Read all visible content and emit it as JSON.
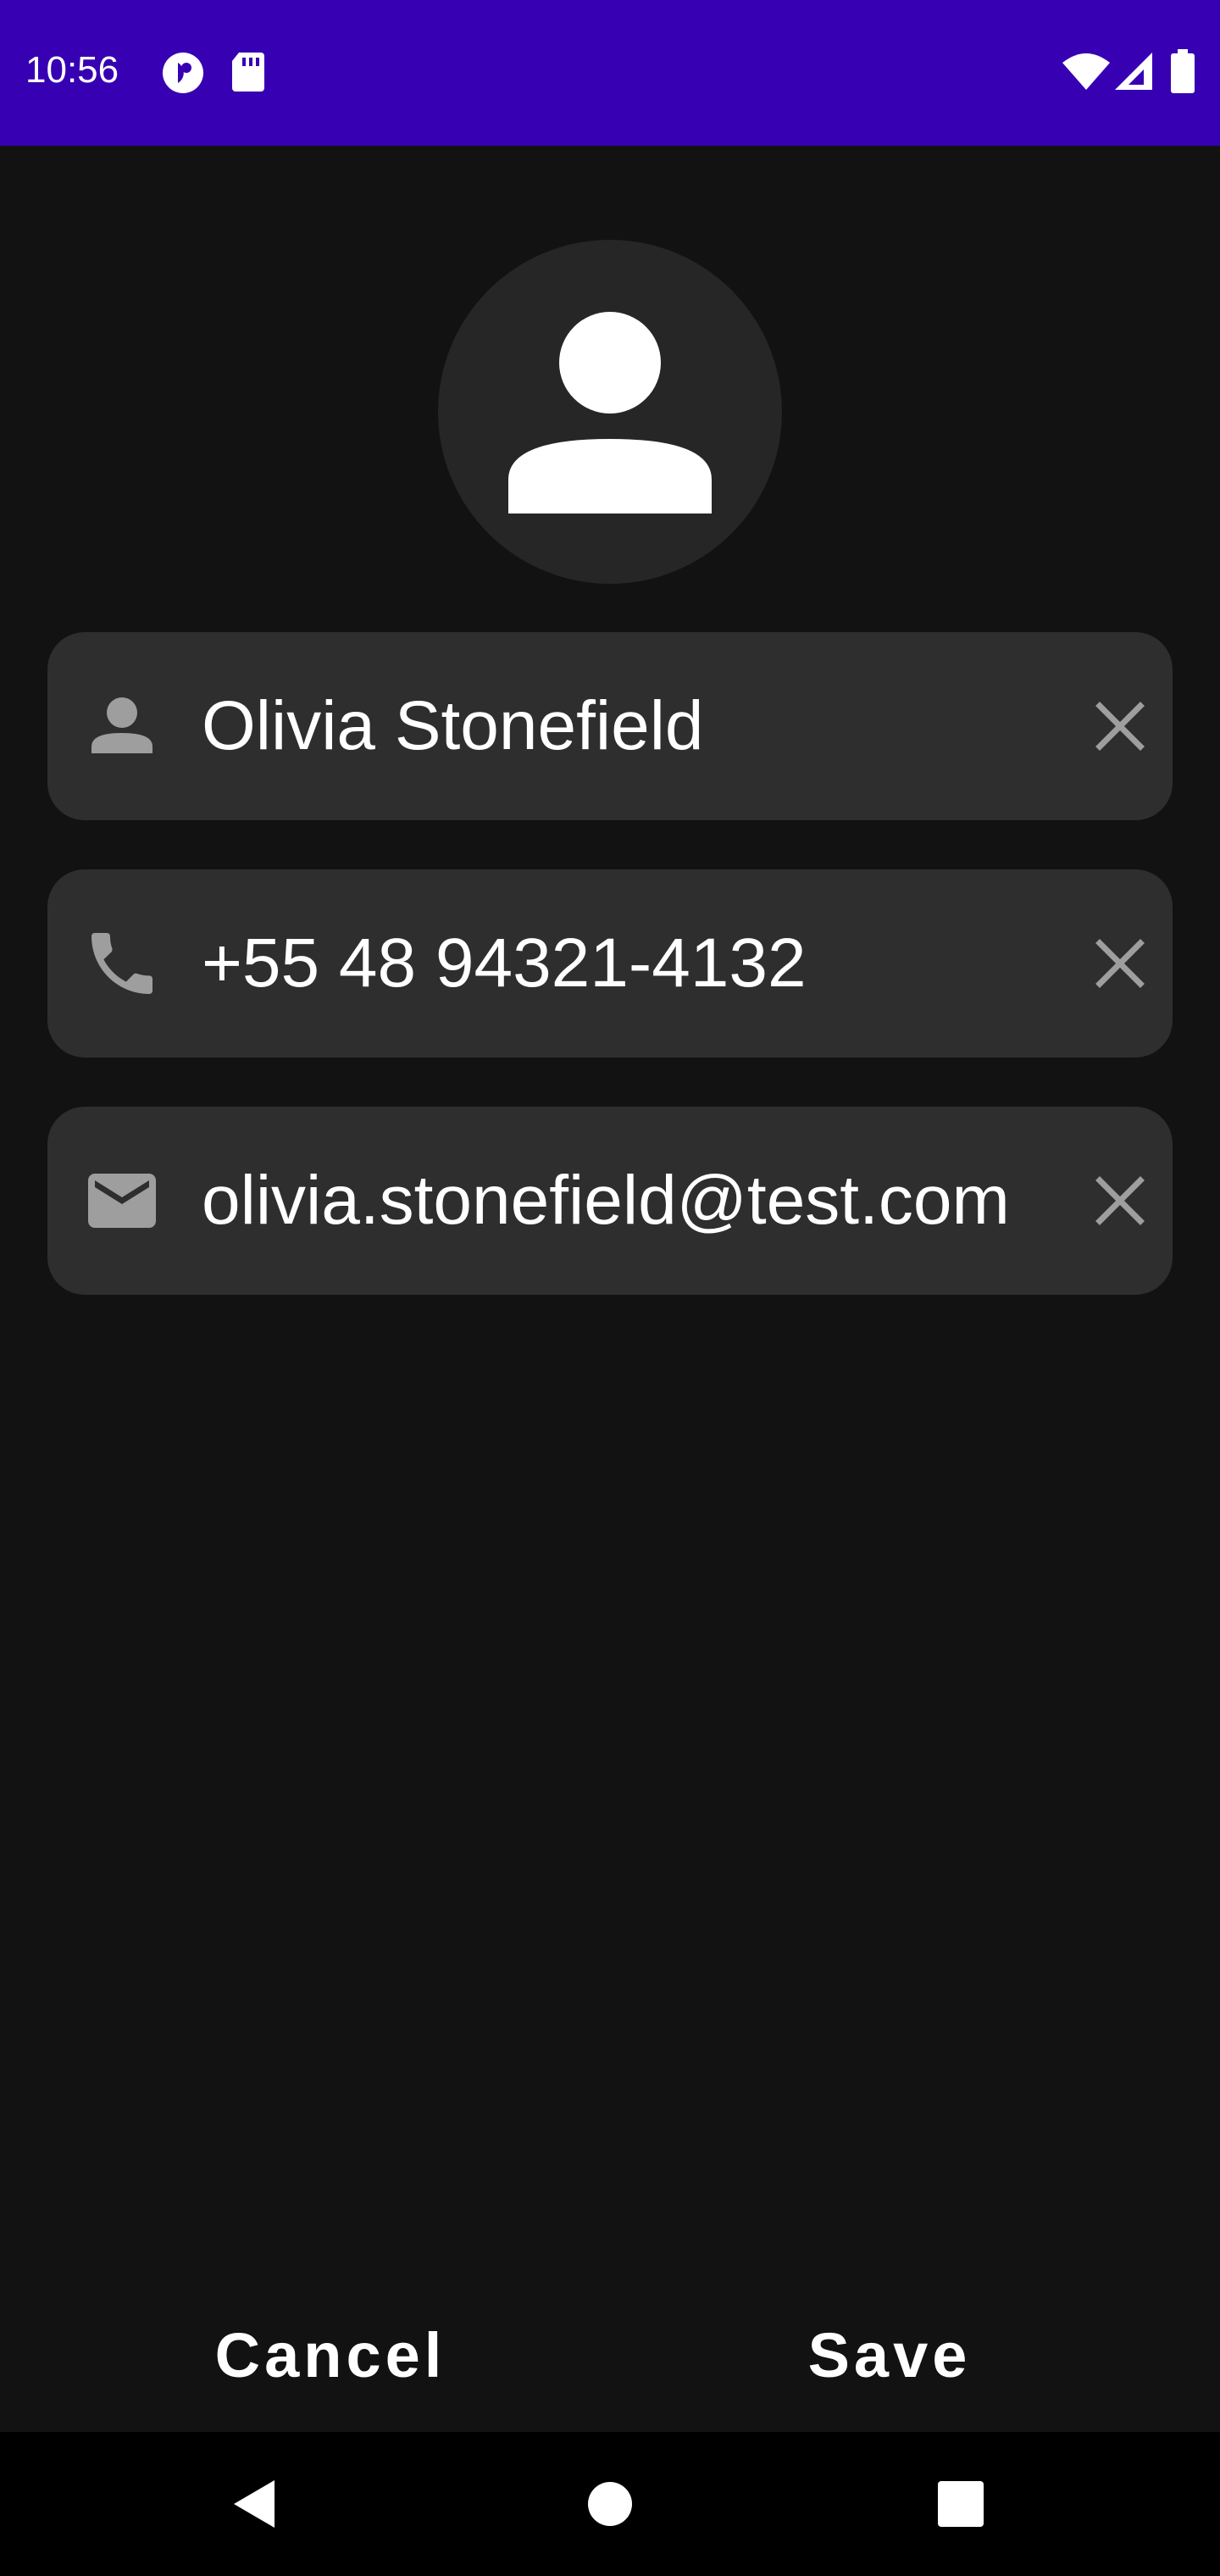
{
  "status_bar": {
    "time": "10:56",
    "icons_left": [
      "data-saver-icon",
      "sd-card-icon"
    ],
    "icons_right": [
      "wifi-icon",
      "cell-signal-icon",
      "battery-icon"
    ],
    "background_color": "#3700b3"
  },
  "avatar": {
    "icon": "person-icon"
  },
  "form": {
    "fields": [
      {
        "icon": "person-icon",
        "value": "Olivia Stonefield",
        "clear_icon": "close-icon"
      },
      {
        "icon": "phone-icon",
        "value": "+55 48 94321-4132",
        "clear_icon": "close-icon"
      },
      {
        "icon": "mail-icon",
        "value": "olivia.stonefield@test.com",
        "clear_icon": "close-icon"
      }
    ]
  },
  "actions": {
    "cancel_label": "Cancel",
    "save_label": "Save"
  },
  "nav_bar": {
    "buttons": [
      "back-icon",
      "home-icon",
      "recents-icon"
    ]
  }
}
